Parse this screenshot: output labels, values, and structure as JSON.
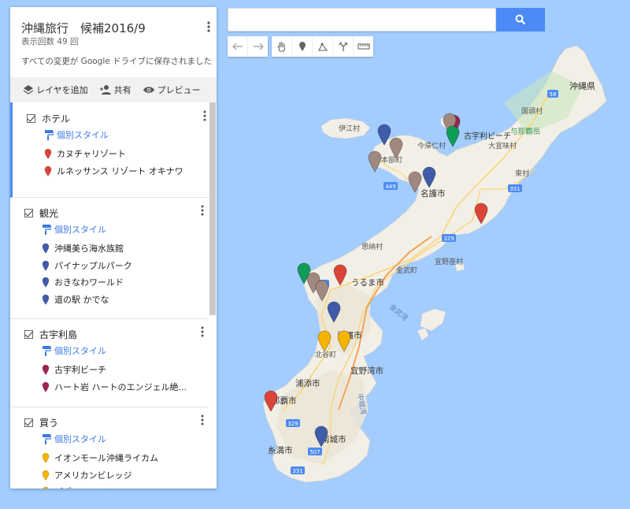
{
  "panel": {
    "title": "沖縄旅行　候補2016/9",
    "views": "表示回数 49 回",
    "saved": "すべての変更が Google ドライブに保存されました",
    "actions": {
      "add_layer": "レイヤを追加",
      "share": "共有",
      "preview": "プレビュー"
    },
    "style_label": "個別スタイル",
    "layers": [
      {
        "name": "ホテル",
        "color": "#db4437",
        "items": [
          "カヌチャリゾート",
          "ルネッサンス リゾート オキナワ"
        ]
      },
      {
        "name": "観光",
        "color": "#3f5ba9",
        "items": [
          "沖縄美ら海水族館",
          "パイナップルパーク",
          "おきなわワールド",
          "道の駅 かでな"
        ]
      },
      {
        "name": "古宇利島",
        "color": "#9c2453",
        "items": [
          "古宇利ビーチ",
          "ハート岩 ハートのエンジェル絶..."
        ]
      },
      {
        "name": "買う",
        "color": "#f4b400",
        "items": [
          "イオンモール沖縄ライカム",
          "アメリカンビレッジ",
          "デポアイランド"
        ]
      }
    ]
  },
  "search": {
    "value": "",
    "placeholder": ""
  },
  "map": {
    "labels": {
      "okinawa_ken": "沖縄県",
      "kunigami": "国頭村",
      "yonaha": "与那覇岳",
      "ogimi": "大宜味村",
      "higashi": "東村",
      "nago": "名護市",
      "motobu": "本部町",
      "nakijin": "今帰仁村",
      "iheya": "伊江村",
      "kouri_beach": "古宇利ビーチ",
      "onna": "恩納村",
      "ginoza": "宜野座村",
      "kin": "金武町",
      "uruma": "うるま市",
      "kin_bay": "金武湾",
      "okinawa_city": "沖縄市",
      "chatan": "北谷町",
      "ginowan": "宜野湾市",
      "urasoe": "浦添市",
      "naha": "那覇市",
      "nakagusuku": "中城湾",
      "nanjo": "南城市",
      "itoman": "糸満市",
      "r58": "58",
      "r449": "449",
      "r331a": "331",
      "r329": "329",
      "r507": "507",
      "r331b": "331",
      "r329b": "329",
      "r58b": "58"
    }
  },
  "colors": {
    "hotel": "#db4437",
    "sight": "#3f5ba9",
    "kouri": "#9c2453",
    "shop": "#f4b400",
    "green": "#0f9d58",
    "gray": "#a1887f",
    "accent": "#4c8bf5"
  }
}
